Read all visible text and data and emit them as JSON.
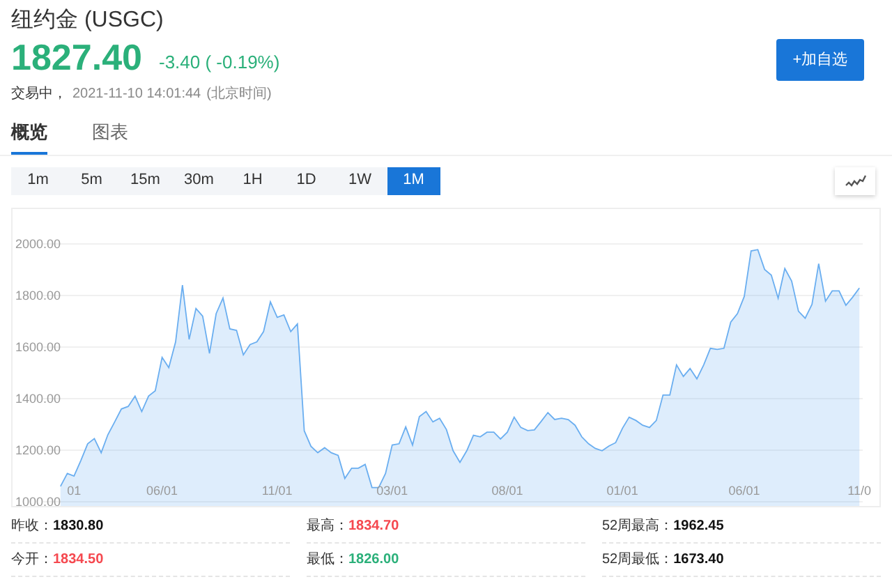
{
  "header": {
    "title": "纽约金 (USGC)",
    "price": "1827.40",
    "change": "-3.40 ( -0.19%)",
    "status": "交易中，",
    "time": "2021-11-10 14:01:44",
    "timezone": "(北京时间)",
    "watch_button": "+加自选"
  },
  "tabs": [
    {
      "label": "概览",
      "selected": true
    },
    {
      "label": "图表",
      "selected": false
    }
  ],
  "periods": [
    {
      "label": "1m",
      "selected": false
    },
    {
      "label": "5m",
      "selected": false
    },
    {
      "label": "15m",
      "selected": false
    },
    {
      "label": "30m",
      "selected": false
    },
    {
      "label": "1H",
      "selected": false
    },
    {
      "label": "1D",
      "selected": false
    },
    {
      "label": "1W",
      "selected": false
    },
    {
      "label": "1M",
      "selected": true
    }
  ],
  "chart": {
    "chart_data": {
      "type": "area",
      "grid": true,
      "ylim": [
        1000,
        2000
      ],
      "yticks": [
        {
          "value": 1000,
          "label": "1000.00"
        },
        {
          "value": 1200,
          "label": "1200.00"
        },
        {
          "value": 1400,
          "label": "1400.00"
        },
        {
          "value": 1600,
          "label": "1600.00"
        },
        {
          "value": 1800,
          "label": "1800.00"
        },
        {
          "value": 2000,
          "label": "2000.00"
        }
      ],
      "categories": [
        null,
        null,
        "01",
        null,
        null,
        null,
        null,
        null,
        null,
        null,
        null,
        null,
        null,
        null,
        null,
        "06/01",
        null,
        null,
        null,
        null,
        null,
        null,
        null,
        null,
        null,
        null,
        null,
        null,
        null,
        null,
        null,
        null,
        "11/01",
        null,
        null,
        null,
        null,
        null,
        null,
        null,
        null,
        null,
        null,
        null,
        null,
        null,
        null,
        null,
        null,
        "03/01",
        null,
        null,
        null,
        null,
        null,
        null,
        null,
        null,
        null,
        null,
        null,
        null,
        null,
        null,
        null,
        null,
        "08/01",
        null,
        null,
        null,
        null,
        null,
        null,
        null,
        null,
        null,
        null,
        null,
        null,
        null,
        null,
        null,
        null,
        "01/01",
        null,
        null,
        null,
        null,
        null,
        null,
        null,
        null,
        null,
        null,
        null,
        null,
        null,
        null,
        null,
        null,
        null,
        "06/01",
        null,
        null,
        null,
        null,
        null,
        null,
        null,
        null,
        null,
        null,
        null,
        null,
        null,
        null,
        null,
        null,
        "11/0"
      ],
      "series": [
        {
          "color": "#6aaef0",
          "values": [
            1060,
            1110,
            1100,
            1160,
            1225,
            1245,
            1190,
            1260,
            1310,
            1360,
            1370,
            1410,
            1350,
            1410,
            1430,
            1560,
            1520,
            1620,
            1840,
            1630,
            1750,
            1720,
            1575,
            1730,
            1790,
            1670,
            1665,
            1570,
            1610,
            1620,
            1660,
            1775,
            1715,
            1725,
            1660,
            1690,
            1275,
            1215,
            1190,
            1210,
            1190,
            1180,
            1090,
            1130,
            1130,
            1145,
            1055,
            1055,
            1110,
            1220,
            1225,
            1290,
            1220,
            1330,
            1350,
            1310,
            1324,
            1280,
            1198,
            1153,
            1198,
            1258,
            1252,
            1270,
            1270,
            1243,
            1270,
            1328,
            1288,
            1276,
            1279,
            1312,
            1346,
            1319,
            1324,
            1319,
            1297,
            1252,
            1225,
            1207,
            1198,
            1216,
            1229,
            1285,
            1328,
            1315,
            1297,
            1288,
            1315,
            1414,
            1414,
            1531,
            1486,
            1517,
            1477,
            1531,
            1595,
            1591,
            1595,
            1697,
            1730,
            1796,
            1973,
            1978,
            1901,
            1879,
            1789,
            1905,
            1856,
            1739,
            1712,
            1766,
            1923,
            1778,
            1818,
            1818,
            1762,
            1793,
            1829
          ]
        }
      ]
    }
  },
  "stats": [
    {
      "label": "昨收：",
      "value": "1830.80",
      "color": "#111111"
    },
    {
      "label": "最高：",
      "value": "1834.70",
      "color": "#f5484f"
    },
    {
      "label": "52周最高：",
      "value": "1962.45",
      "color": "#111111"
    },
    {
      "label": "今开：",
      "value": "1834.50",
      "color": "#f5484f"
    },
    {
      "label": "最低：",
      "value": "1826.00",
      "color": "#2bb07a"
    },
    {
      "label": "52周最低：",
      "value": "1673.40",
      "color": "#111111"
    }
  ]
}
